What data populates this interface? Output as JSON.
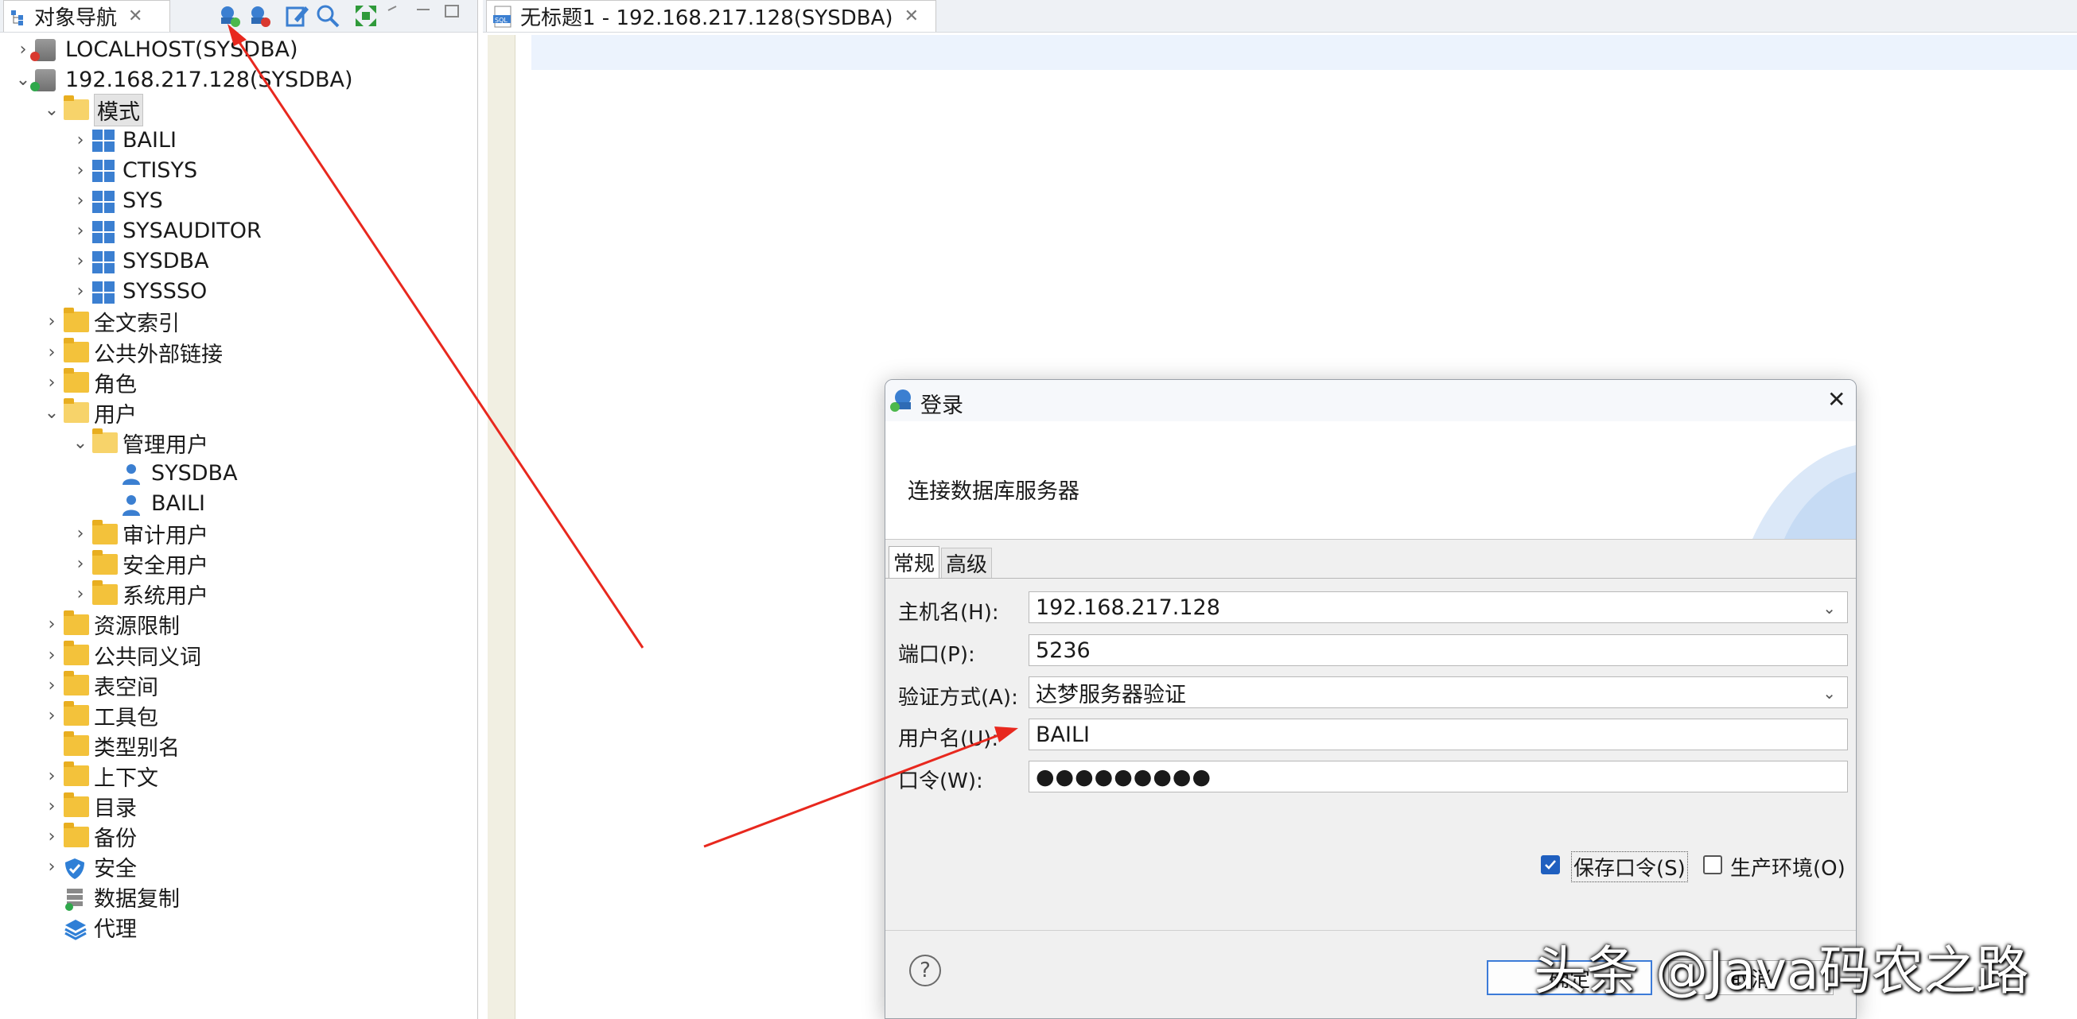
{
  "nav_panel": {
    "tab_label": "对象导航",
    "tab_close": "✕"
  },
  "tree": [
    {
      "label": "LOCALHOST(SYSDBA)",
      "icon": "database-icon",
      "expander": "collapsed",
      "level": 0
    },
    {
      "label": "192.168.217.128(SYSDBA)",
      "icon": "database-connected-icon",
      "expander": "expanded",
      "level": 0
    },
    {
      "label": "模式",
      "icon": "folder-open-icon",
      "expander": "expanded",
      "level": 1,
      "selected": true
    },
    {
      "label": "BAILI",
      "icon": "schema-icon",
      "expander": "collapsed",
      "level": 2
    },
    {
      "label": "CTISYS",
      "icon": "schema-icon",
      "expander": "collapsed",
      "level": 2
    },
    {
      "label": "SYS",
      "icon": "schema-icon",
      "expander": "collapsed",
      "level": 2
    },
    {
      "label": "SYSAUDITOR",
      "icon": "schema-icon",
      "expander": "collapsed",
      "level": 2
    },
    {
      "label": "SYSDBA",
      "icon": "schema-icon",
      "expander": "collapsed",
      "level": 2
    },
    {
      "label": "SYSSSO",
      "icon": "schema-icon",
      "expander": "collapsed",
      "level": 2
    },
    {
      "label": "全文索引",
      "icon": "folder-icon",
      "expander": "collapsed",
      "level": 1
    },
    {
      "label": "公共外部链接",
      "icon": "folder-icon",
      "expander": "collapsed",
      "level": 1
    },
    {
      "label": "角色",
      "icon": "folder-icon",
      "expander": "collapsed",
      "level": 1
    },
    {
      "label": "用户",
      "icon": "folder-open-icon",
      "expander": "expanded",
      "level": 1
    },
    {
      "label": "管理用户",
      "icon": "folder-open-icon",
      "expander": "expanded",
      "level": 2
    },
    {
      "label": "SYSDBA",
      "icon": "user-icon",
      "expander": "none",
      "level": 3
    },
    {
      "label": "BAILI",
      "icon": "user-icon",
      "expander": "none",
      "level": 3
    },
    {
      "label": "审计用户",
      "icon": "folder-icon",
      "expander": "collapsed",
      "level": 2
    },
    {
      "label": "安全用户",
      "icon": "folder-icon",
      "expander": "collapsed",
      "level": 2
    },
    {
      "label": "系统用户",
      "icon": "folder-icon",
      "expander": "collapsed",
      "level": 2
    },
    {
      "label": "资源限制",
      "icon": "folder-icon",
      "expander": "collapsed",
      "level": 1
    },
    {
      "label": "公共同义词",
      "icon": "folder-icon",
      "expander": "collapsed",
      "level": 1
    },
    {
      "label": "表空间",
      "icon": "folder-icon",
      "expander": "collapsed",
      "level": 1
    },
    {
      "label": "工具包",
      "icon": "folder-icon",
      "expander": "collapsed",
      "level": 1
    },
    {
      "label": "类型别名",
      "icon": "folder-icon",
      "expander": "none",
      "level": 1
    },
    {
      "label": "上下文",
      "icon": "folder-icon",
      "expander": "collapsed",
      "level": 1
    },
    {
      "label": "目录",
      "icon": "folder-icon",
      "expander": "collapsed",
      "level": 1
    },
    {
      "label": "备份",
      "icon": "folder-icon",
      "expander": "collapsed",
      "level": 1
    },
    {
      "label": "安全",
      "icon": "shield-icon",
      "expander": "collapsed",
      "level": 1
    },
    {
      "label": "数据复制",
      "icon": "replication-icon",
      "expander": "none",
      "level": 1
    },
    {
      "label": "代理",
      "icon": "layers-icon",
      "expander": "none",
      "level": 1
    }
  ],
  "editor": {
    "tab_label": "无标题1 - 192.168.217.128(SYSDBA)",
    "tab_close": "✕"
  },
  "dialog": {
    "title": "登录",
    "close": "✕",
    "banner_text": "连接数据库服务器",
    "tabs": [
      "常规",
      "高级"
    ],
    "fields": {
      "host_label": "主机名(H):",
      "host_value": "192.168.217.128",
      "port_label": "端口(P):",
      "port_value": "5236",
      "auth_label": "验证方式(A):",
      "auth_value": "达梦服务器验证",
      "user_label": "用户名(U):",
      "user_value": "BAILI",
      "password_label": "口令(W):",
      "password_value": "●●●●●●●●●"
    },
    "save_password": {
      "label": "保存口令(S)",
      "checked": true
    },
    "production_env": {
      "label": "生产环境(O)",
      "checked": false
    },
    "help": "?",
    "ok_label": "确定",
    "cancel_label": "取消"
  },
  "colors": {
    "accent": "#1f5fbf",
    "annotation_arrow": "#e8281e",
    "folder": "#f3c23b"
  },
  "watermark": "头条 @Java码农之路"
}
